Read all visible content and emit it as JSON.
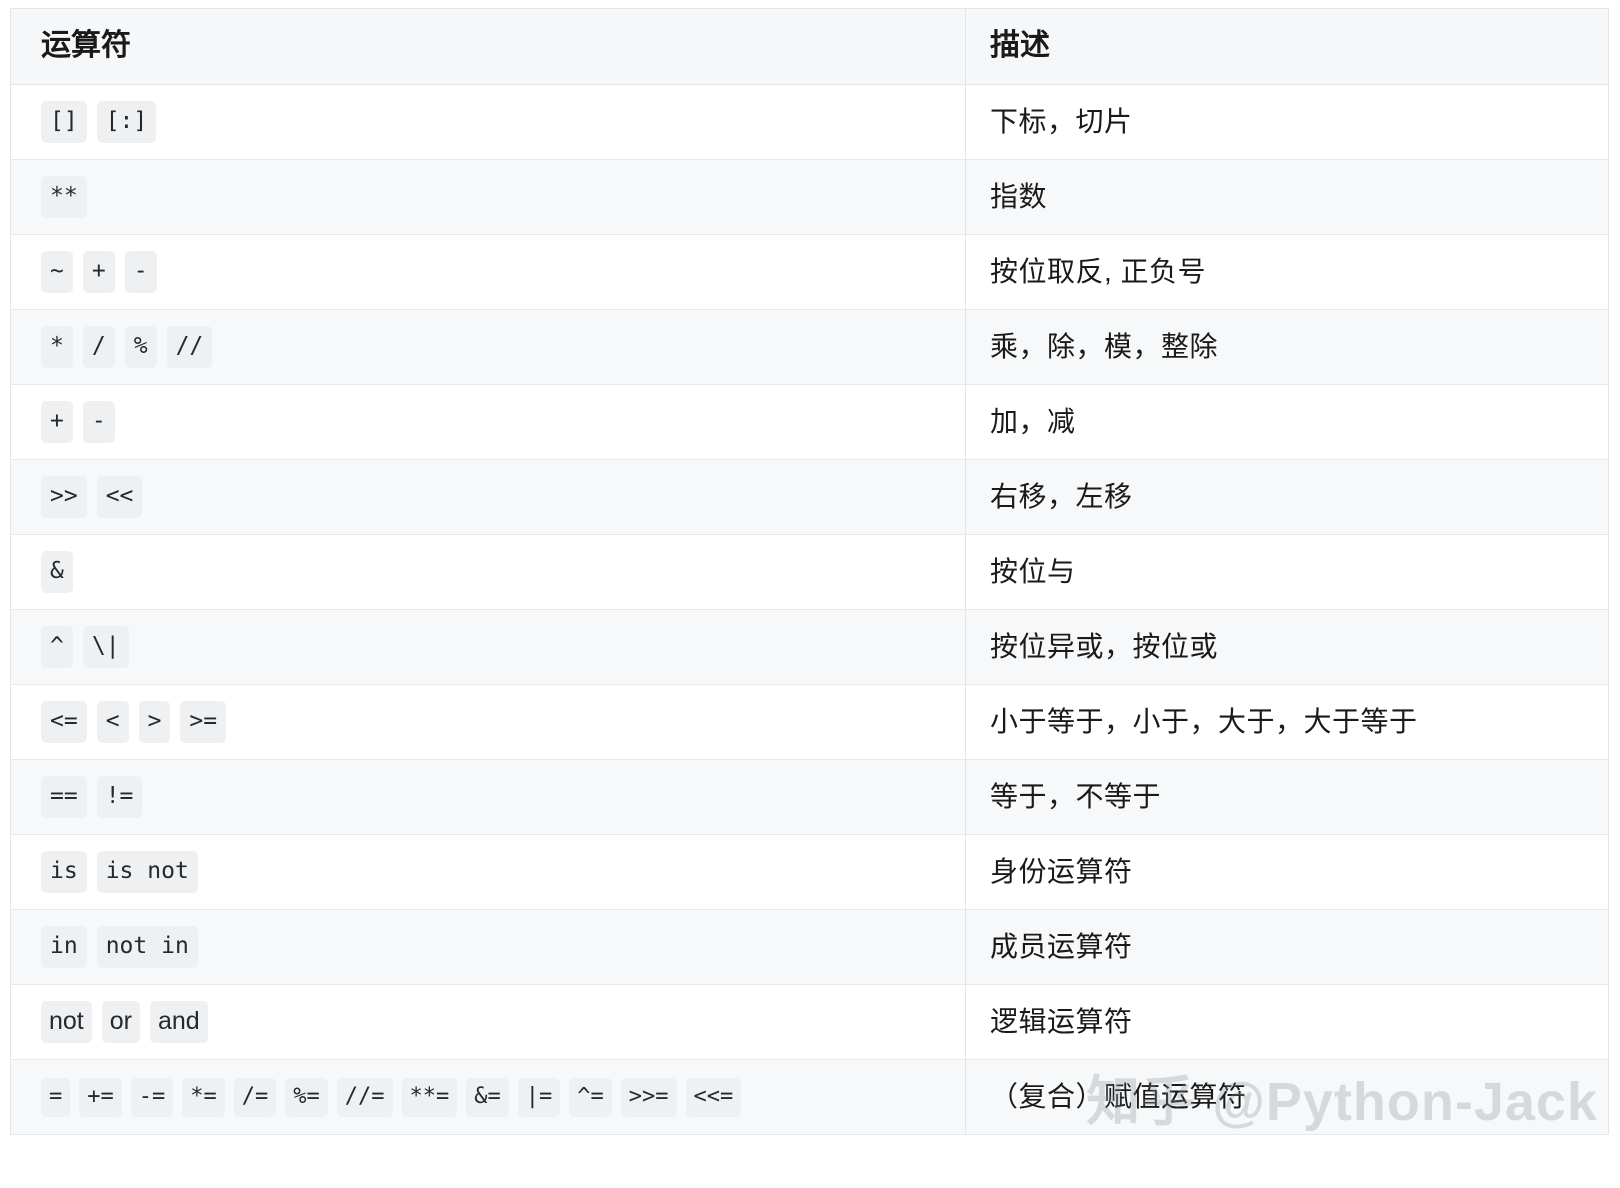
{
  "table": {
    "headers": {
      "operator": "运算符",
      "description": "描述"
    },
    "rows": [
      {
        "operators": [
          "[]",
          "[:]"
        ],
        "kinds": [
          "mono",
          "mono"
        ],
        "description": "下标，切片"
      },
      {
        "operators": [
          "**"
        ],
        "kinds": [
          "mono"
        ],
        "description": "指数"
      },
      {
        "operators": [
          "~",
          "+",
          "-"
        ],
        "kinds": [
          "mono",
          "mono",
          "mono"
        ],
        "description": "按位取反, 正负号"
      },
      {
        "operators": [
          "*",
          "/",
          "%",
          "//"
        ],
        "kinds": [
          "mono",
          "mono",
          "mono",
          "mono"
        ],
        "description": "乘，除，模，整除"
      },
      {
        "operators": [
          "+",
          "-"
        ],
        "kinds": [
          "mono",
          "mono"
        ],
        "description": "加，减"
      },
      {
        "operators": [
          ">>",
          "<<"
        ],
        "kinds": [
          "mono",
          "mono"
        ],
        "description": "右移，左移"
      },
      {
        "operators": [
          "&"
        ],
        "kinds": [
          "mono"
        ],
        "description": "按位与"
      },
      {
        "operators": [
          "^",
          "\\|"
        ],
        "kinds": [
          "mono",
          "mono"
        ],
        "description": "按位异或，按位或"
      },
      {
        "operators": [
          "<=",
          "<",
          ">",
          ">="
        ],
        "kinds": [
          "mono",
          "mono",
          "mono",
          "mono"
        ],
        "description": "小于等于，小于，大于，大于等于"
      },
      {
        "operators": [
          "==",
          "!="
        ],
        "kinds": [
          "mono",
          "mono"
        ],
        "description": "等于，不等于"
      },
      {
        "operators": [
          "is",
          "is not"
        ],
        "kinds": [
          "mono",
          "mono"
        ],
        "description": "身份运算符"
      },
      {
        "operators": [
          "in",
          "not in"
        ],
        "kinds": [
          "mono",
          "mono"
        ],
        "description": "成员运算符"
      },
      {
        "operators": [
          "not",
          "or",
          "and"
        ],
        "kinds": [
          "word",
          "word",
          "word"
        ],
        "description": "逻辑运算符"
      },
      {
        "operators": [
          "=",
          "+=",
          "-=",
          "*=",
          "/=",
          "%=",
          "//=",
          "**=",
          "&=",
          "|=",
          "^=",
          ">>=",
          "<<="
        ],
        "kinds": [
          "mono",
          "mono",
          "mono",
          "mono",
          "mono",
          "mono",
          "mono",
          "mono",
          "mono",
          "mono",
          "mono",
          "mono",
          "mono"
        ],
        "description": "（复合）赋值运算符"
      }
    ]
  },
  "watermark": {
    "text": "知乎 @Python-Jack"
  },
  "colors": {
    "header_bg": "#f6f7f8",
    "stripe_bg": "#f7f8f9",
    "row_bg": "#ffffff",
    "border": "#e3e5e7",
    "badge_bg": "#eff0f1",
    "text": "#1a1a1a",
    "watermark": "#8c9196"
  }
}
